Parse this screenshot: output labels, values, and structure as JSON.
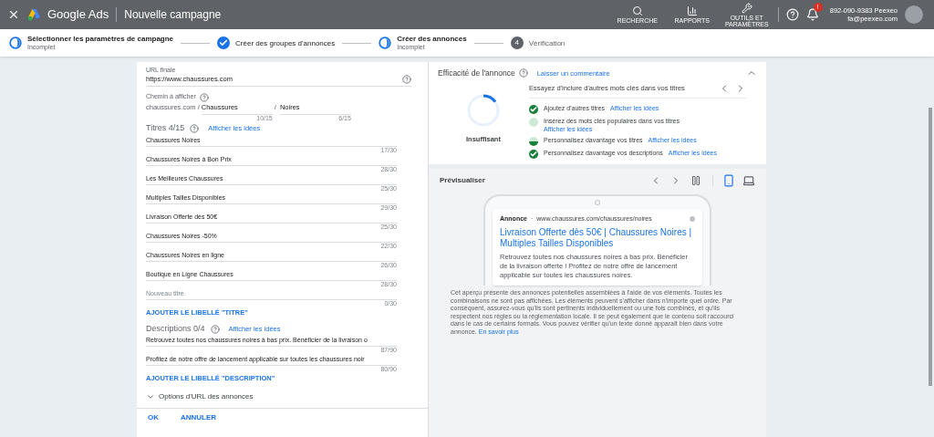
{
  "header": {
    "product": "Google Ads",
    "page_title": "Nouvelle campagne",
    "tools": [
      {
        "kind": "search",
        "label": "RECHERCHE"
      },
      {
        "kind": "reports",
        "label": "RAPPORTS"
      },
      {
        "kind": "tools",
        "label": "OUTILS ET PARAMÈTRES"
      }
    ],
    "notification_badge": "!",
    "account": {
      "phone": "892-090-9383 Peexeo",
      "email": "fa@peexeo.com"
    }
  },
  "steps": [
    {
      "label": "Sélectionner les paramètres de campagne",
      "sublabel": "Incomplet",
      "kind": "partial"
    },
    {
      "label": "Créer des groupes d'annonces",
      "kind": "done"
    },
    {
      "label": "Créer des annonces",
      "sublabel": "Incomplet",
      "kind": "partial"
    },
    {
      "label": "Vérification",
      "number": "4",
      "kind": "numbered"
    }
  ],
  "form": {
    "url": {
      "label": "URL finale",
      "value": "https://www.chaussures.com"
    },
    "path": {
      "label": "Chemin à afficher",
      "domain": "chaussures.com /",
      "separator": "/",
      "fields": [
        {
          "value": "Chaussures",
          "counter": "10/15"
        },
        {
          "value": "Noires",
          "counter": "6/15"
        }
      ]
    },
    "headlines": {
      "heading": "Titres 4/15",
      "link": "Afficher les idées",
      "items": [
        {
          "value": "Chaussures Noires",
          "counter": "17/30"
        },
        {
          "value": "Chaussures Noires à Bon Prix",
          "counter": "28/30"
        },
        {
          "value": "Les Meilleures Chaussures",
          "counter": "25/30"
        },
        {
          "value": "Multiples Tailles Disponibles",
          "counter": "29/30"
        },
        {
          "value": "Livraison Offerte dès 50€",
          "counter": "25/30"
        },
        {
          "value": "Chaussures Noires -50%",
          "counter": "22/30"
        },
        {
          "value": "Chaussures Noires en ligne",
          "counter": "26/30"
        },
        {
          "value": "Boutique en Ligne Chaussures",
          "counter": "28/30"
        }
      ],
      "new_item": {
        "placeholder": "Nouveau titre",
        "counter": "0/30"
      },
      "add_label": "AJOUTER LE LIBELLÉ \"TITRE\""
    },
    "descriptions": {
      "heading": "Descriptions 0/4",
      "link": "Afficher les idées",
      "items": [
        {
          "value": "Retrouvez toutes nos chaussures noires à bas prix. Bénéficier de la livraison o",
          "counter": "87/90"
        },
        {
          "value": "Profitez de notre offre de lancement applicable sur toutes les chaussures noir",
          "counter": "80/90"
        }
      ],
      "add_label": "AJOUTER LE LIBELLÉ \"DESCRIPTION\""
    },
    "url_options": {
      "label": "Options d'URL des annonces",
      "expanded": false
    },
    "buttons": [
      "OK",
      "ANNULER"
    ]
  },
  "strength": {
    "title": "Efficacité de l'annonce",
    "link": "Laisser un commentaire",
    "rating": "Insuffisant",
    "level": 0.15,
    "tip": "Essayez d'inclure d'autres mots clés dans vos titres",
    "suggestions": [
      {
        "text": "Ajoutez d'autres titres",
        "link": "Afficher les idées",
        "kind": "done"
      },
      {
        "text": "Insérez des mots clés populaires dans vos titres",
        "link": "Afficher les idées",
        "kind": "empty"
      },
      {
        "text": "Personnalisez davantage vos titres",
        "link": "Afficher les idées",
        "kind": "partial"
      },
      {
        "text": "Personnalisez davantage vos descriptions",
        "link": "Afficher les idées",
        "kind": "done"
      }
    ]
  },
  "preview": {
    "title": "Prévisualiser",
    "views": [
      {
        "kind": "mobile",
        "selected": true
      },
      {
        "kind": "desktop",
        "selected": false
      }
    ],
    "ad": {
      "badge": "Annonce",
      "separator": "·",
      "url": "www.chaussures.com/chaussures/noires",
      "headline": "Livraison Offerte dès 50€ | Chaussures Noires | Multiples Tailles Disponibles",
      "description": "Retrouvez toutes nos chaussures noires à bas prix. Bénéficier de la livraison offerte ! Profitez de notre offre de lancement applicable sur toutes les chaussures noires."
    },
    "disclaimer": "Cet aperçu présente des annonces potentielles assemblées à l'aide de vos éléments. Toutes les combinaisons ne sont pas affichées. Les éléments peuvent s'afficher dans n'importe quel ordre. Par conséquent, assurez-vous qu'ils sont pertinents individuellement ou une fois combinés, et qu'ils respectent nos règles ou la réglementation locale. Il se peut également que le contenu soit raccourci dans le cas de certains formats. Vous pouvez vérifier qu'un texte donné apparaît bien dans votre annonce.",
    "learn_more": "En savoir plus"
  }
}
